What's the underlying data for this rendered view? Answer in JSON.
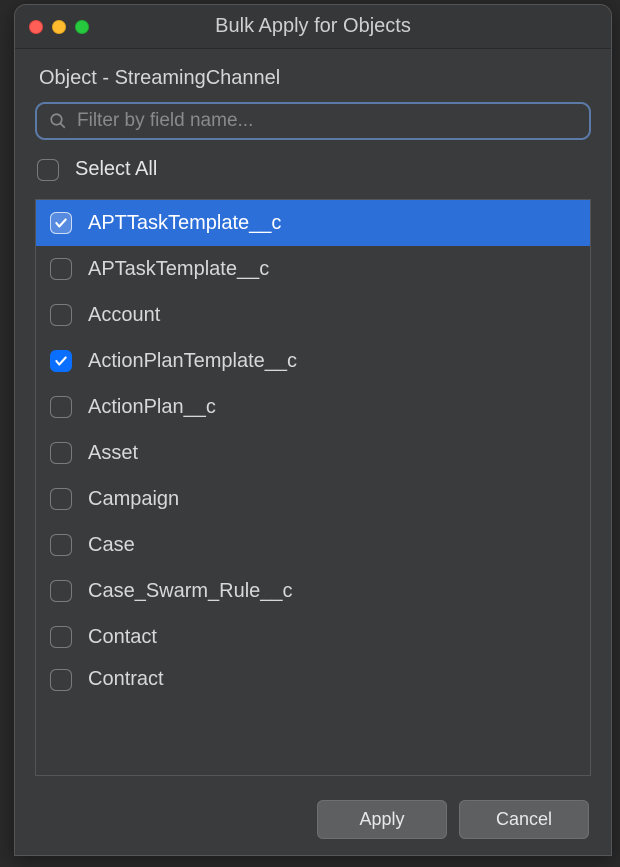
{
  "titlebar": {
    "title": "Bulk Apply for Objects"
  },
  "subtitle": "Object - StreamingChannel",
  "search": {
    "placeholder": "Filter by field name..."
  },
  "selectAll": {
    "label": "Select All"
  },
  "list": {
    "items": [
      {
        "label": "APTTaskTemplate__c",
        "checked": true,
        "selected": true
      },
      {
        "label": "APTaskTemplate__c",
        "checked": false,
        "selected": false
      },
      {
        "label": "Account",
        "checked": false,
        "selected": false
      },
      {
        "label": "ActionPlanTemplate__c",
        "checked": true,
        "selected": false
      },
      {
        "label": "ActionPlan__c",
        "checked": false,
        "selected": false
      },
      {
        "label": "Asset",
        "checked": false,
        "selected": false
      },
      {
        "label": "Campaign",
        "checked": false,
        "selected": false
      },
      {
        "label": "Case",
        "checked": false,
        "selected": false
      },
      {
        "label": "Case_Swarm_Rule__c",
        "checked": false,
        "selected": false
      },
      {
        "label": "Contact",
        "checked": false,
        "selected": false
      },
      {
        "label": "Contract",
        "checked": false,
        "selected": false,
        "cut": true
      }
    ]
  },
  "buttons": {
    "apply": "Apply",
    "cancel": "Cancel"
  }
}
